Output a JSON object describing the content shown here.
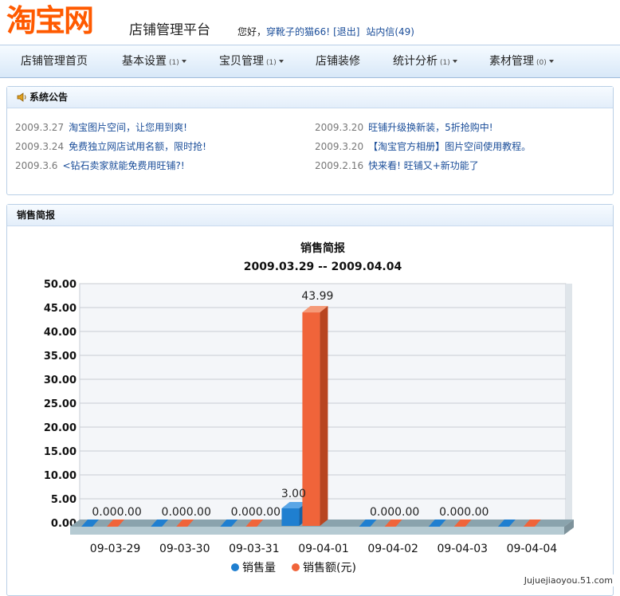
{
  "header": {
    "logo": "淘宝网",
    "platform": "店铺管理平台",
    "greeting": "您好，",
    "username": "穿靴子的猫66!",
    "logout": "[退出]",
    "messages": "站内信(49)"
  },
  "nav": {
    "items": [
      {
        "label": "店铺管理首页",
        "count": "",
        "dropdown": false
      },
      {
        "label": "基本设置",
        "count": "(1)",
        "dropdown": true
      },
      {
        "label": "宝贝管理",
        "count": "(1)",
        "dropdown": true
      },
      {
        "label": "店铺装修",
        "count": "",
        "dropdown": false
      },
      {
        "label": "统计分析",
        "count": "(1)",
        "dropdown": true
      },
      {
        "label": "素材管理",
        "count": "(0)",
        "dropdown": true
      }
    ]
  },
  "notices": {
    "title": "系统公告",
    "items": [
      {
        "date": "2009.3.27",
        "text": "淘宝图片空间，让您用到爽!"
      },
      {
        "date": "2009.3.20",
        "text": "旺铺升级换新装，5折抢购中!"
      },
      {
        "date": "2009.3.24",
        "text": "免费独立网店试用名额，限时抢!"
      },
      {
        "date": "2009.3.20",
        "text": "【淘宝官方相册】图片空间使用教程。"
      },
      {
        "date": "2009.3.6",
        "text": "<钻石卖家就能免费用旺铺?!"
      },
      {
        "date": "2009.2.16",
        "text": "快来看! 旺铺又+新功能了"
      }
    ]
  },
  "sales": {
    "panel_title": "销售简报"
  },
  "chart_data": {
    "type": "bar",
    "title": "销售简报",
    "subtitle": "2009.03.29 -- 2009.04.04",
    "categories": [
      "09-03-29",
      "09-03-30",
      "09-03-31",
      "09-04-01",
      "09-04-02",
      "09-04-03",
      "09-04-04"
    ],
    "series": [
      {
        "name": "销售量",
        "values": [
          0,
          0,
          0,
          3,
          0,
          0,
          0
        ],
        "color": "#1f7fd0"
      },
      {
        "name": "销售额(元)",
        "values": [
          0,
          0,
          0,
          43.99,
          0,
          0,
          0
        ],
        "color": "#f0643a"
      }
    ],
    "data_labels": [
      "0.000.00",
      "0.000.00",
      "0.000.00",
      "3.00",
      "43.99",
      "0.000.00",
      "0.000.00",
      "0.000.00"
    ],
    "ylim": [
      0,
      50
    ],
    "yticks": [
      "0.00",
      "5.00",
      "10.00",
      "15.00",
      "20.00",
      "25.00",
      "30.00",
      "35.00",
      "40.00",
      "45.00",
      "50.00"
    ],
    "grid": true,
    "legend": "bottom-center"
  },
  "watermark": "Jujuejiaoyou.51.com",
  "colors": {
    "brand": "#ff5a00",
    "link": "#1a4d99",
    "nav_bg": "#dbe9f8"
  }
}
